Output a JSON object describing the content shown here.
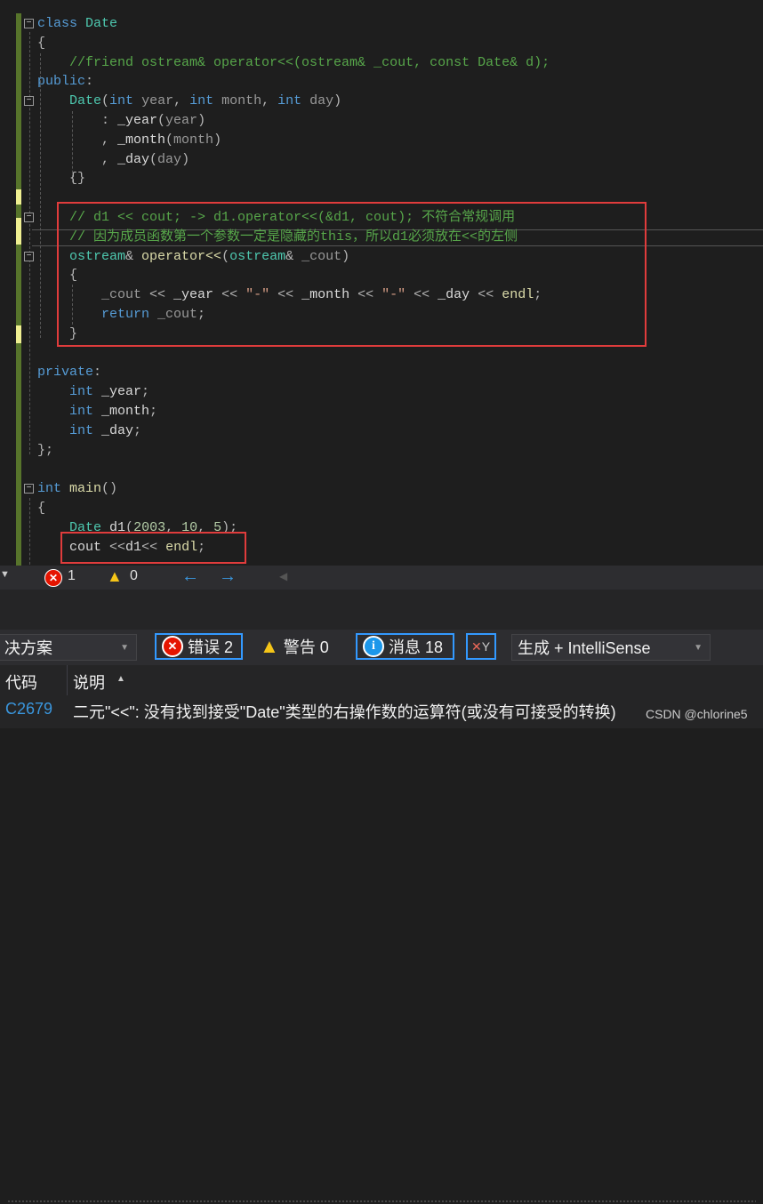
{
  "code_lines": [
    [
      [
        "kw",
        "class "
      ],
      [
        "ty",
        "Date"
      ]
    ],
    [
      [
        "op",
        "{"
      ]
    ],
    [
      [
        "cm",
        "    //friend ostream& operator<<(ostream& _cout, const Date& d);"
      ]
    ],
    [
      [
        "kw",
        "public"
      ],
      [
        "op",
        ":"
      ]
    ],
    [
      [
        "op",
        "    "
      ],
      [
        "ty",
        "Date"
      ],
      [
        "op",
        "("
      ],
      [
        "kw",
        "int "
      ],
      [
        "pa",
        "year"
      ],
      [
        "op",
        ", "
      ],
      [
        "kw",
        "int "
      ],
      [
        "pa",
        "month"
      ],
      [
        "op",
        ", "
      ],
      [
        "kw",
        "int "
      ],
      [
        "pa",
        "day"
      ],
      [
        "op",
        ")"
      ]
    ],
    [
      [
        "op",
        "        : "
      ],
      [
        "me",
        "_year"
      ],
      [
        "op",
        "("
      ],
      [
        "pa",
        "year"
      ],
      [
        "op",
        ")"
      ]
    ],
    [
      [
        "op",
        "        , "
      ],
      [
        "me",
        "_month"
      ],
      [
        "op",
        "("
      ],
      [
        "pa",
        "month"
      ],
      [
        "op",
        ")"
      ]
    ],
    [
      [
        "op",
        "        , "
      ],
      [
        "me",
        "_day"
      ],
      [
        "op",
        "("
      ],
      [
        "pa",
        "day"
      ],
      [
        "op",
        ")"
      ]
    ],
    [
      [
        "op",
        "    {}"
      ]
    ],
    [
      [
        "op",
        ""
      ]
    ],
    [
      [
        "cm",
        "    // d1 << cout; -> d1.operator<<(&d1, cout); 不符合常规调用"
      ]
    ],
    [
      [
        "cm",
        "    // 因为成员函数第一个参数一定是隐藏的this，所以d1必须放在<<的左侧"
      ]
    ],
    [
      [
        "op",
        "    "
      ],
      [
        "ty",
        "ostream"
      ],
      [
        "op",
        "& "
      ],
      [
        "fn",
        "operator<<"
      ],
      [
        "op",
        "("
      ],
      [
        "ty",
        "ostream"
      ],
      [
        "op",
        "& "
      ],
      [
        "pa",
        "_cout"
      ],
      [
        "op",
        ")"
      ]
    ],
    [
      [
        "op",
        "    {"
      ]
    ],
    [
      [
        "op",
        "        "
      ],
      [
        "pa",
        "_cout"
      ],
      [
        "op",
        " << "
      ],
      [
        "me",
        "_year"
      ],
      [
        "op",
        " << "
      ],
      [
        "st",
        "\"-\""
      ],
      [
        "op",
        " << "
      ],
      [
        "me",
        "_month"
      ],
      [
        "op",
        " << "
      ],
      [
        "st",
        "\"-\""
      ],
      [
        "op",
        " << "
      ],
      [
        "me",
        "_day"
      ],
      [
        "op",
        " << "
      ],
      [
        "fn",
        "endl"
      ],
      [
        "op",
        ";"
      ]
    ],
    [
      [
        "op",
        "        "
      ],
      [
        "kw",
        "return "
      ],
      [
        "pa",
        "_cout"
      ],
      [
        "op",
        ";"
      ]
    ],
    [
      [
        "op",
        "    }"
      ]
    ],
    [
      [
        "op",
        ""
      ]
    ],
    [
      [
        "kw",
        "private"
      ],
      [
        "op",
        ":"
      ]
    ],
    [
      [
        "op",
        "    "
      ],
      [
        "kw",
        "int "
      ],
      [
        "me",
        "_year"
      ],
      [
        "op",
        ";"
      ]
    ],
    [
      [
        "op",
        "    "
      ],
      [
        "kw",
        "int "
      ],
      [
        "me",
        "_month"
      ],
      [
        "op",
        ";"
      ]
    ],
    [
      [
        "op",
        "    "
      ],
      [
        "kw",
        "int "
      ],
      [
        "me",
        "_day"
      ],
      [
        "op",
        ";"
      ]
    ],
    [
      [
        "op",
        "};"
      ]
    ],
    [
      [
        "op",
        ""
      ]
    ],
    [
      [
        "kw",
        "int "
      ],
      [
        "fn",
        "main"
      ],
      [
        "op",
        "()"
      ]
    ],
    [
      [
        "op",
        "{"
      ]
    ],
    [
      [
        "op",
        "    "
      ],
      [
        "ty",
        "Date "
      ],
      [
        "me",
        "d1"
      ],
      [
        "op",
        "("
      ],
      [
        "nu",
        "2003"
      ],
      [
        "op",
        ", "
      ],
      [
        "nu",
        "10"
      ],
      [
        "op",
        ", "
      ],
      [
        "nu",
        "5"
      ],
      [
        "op",
        ");"
      ]
    ],
    [
      [
        "op",
        "    "
      ],
      [
        "me",
        "cout "
      ],
      [
        "op",
        "<<"
      ],
      [
        "me",
        "d1"
      ],
      [
        "op",
        "<< "
      ],
      [
        "fn",
        "endl"
      ],
      [
        "op",
        ";"
      ]
    ]
  ],
  "status": {
    "errors": "1",
    "warnings": "0"
  },
  "error_list": {
    "scope_combo": "决方案",
    "errors_btn": "错误 2",
    "warnings_btn": "警告 0",
    "messages_btn": "消息 18",
    "source_combo": "生成 + IntelliSense",
    "col_code": "代码",
    "col_desc": "说明",
    "rows": [
      {
        "code": "C2679",
        "desc": "二元\"<<\": 没有找到接受\"Date\"类型的右操作数的运算符(或没有可接受的转换)"
      }
    ]
  },
  "watermark": "CSDN @chlorine5"
}
